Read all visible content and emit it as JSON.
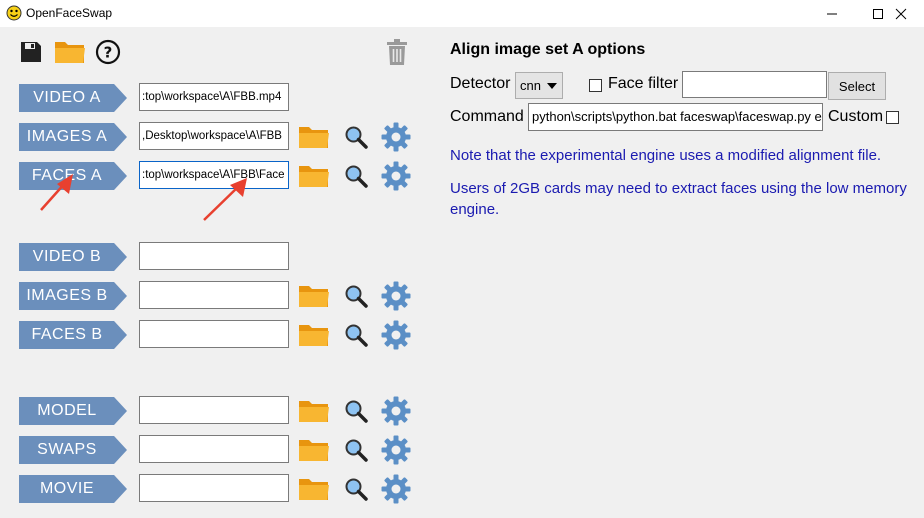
{
  "window": {
    "title": "OpenFaceSwap",
    "controls": [
      "minimize-icon",
      "maximize-icon",
      "close-icon"
    ]
  },
  "toolbar": {
    "icons": [
      "save-icon",
      "open-folder-icon",
      "help-icon",
      "trash-icon"
    ]
  },
  "rows": [
    {
      "label": "VIDEO A",
      "value": ":top\\workspace\\A\\FBB.mp4",
      "tools": false
    },
    {
      "label": "IMAGES A",
      "value": ",Desktop\\workspace\\A\\FBB",
      "tools": true
    },
    {
      "label": "FACES A",
      "value": ":top\\workspace\\A\\FBB\\Face",
      "tools": true
    },
    {
      "label": "VIDEO B",
      "value": "",
      "tools": false
    },
    {
      "label": "IMAGES B",
      "value": "",
      "tools": true
    },
    {
      "label": "FACES B",
      "value": "",
      "tools": true
    },
    {
      "label": "MODEL",
      "value": "",
      "tools": true
    },
    {
      "label": "SWAPS",
      "value": "",
      "tools": true
    },
    {
      "label": "MOVIE",
      "value": "",
      "tools": true
    }
  ],
  "options": {
    "title": "Align image set A options",
    "detector_label": "Detector",
    "detector_value": "cnn",
    "face_filter_label": "Face filter",
    "face_filter_value": "",
    "select_button": "Select",
    "command_label": "Command",
    "command_value": "python\\scripts\\python.bat faceswap\\faceswap.py extra",
    "custom_label": "Custom",
    "note1": "Note that the experimental engine uses a modified alignment file.",
    "note2": "Users of 2GB cards may need to extract faces using the low memory engine."
  },
  "colors": {
    "label_bg": "#6b8fbc",
    "folder": "#f5a623",
    "gear": "#5b8fc6",
    "note_text": "#1a1ab0",
    "annotation_arrow": "#e8402f"
  }
}
